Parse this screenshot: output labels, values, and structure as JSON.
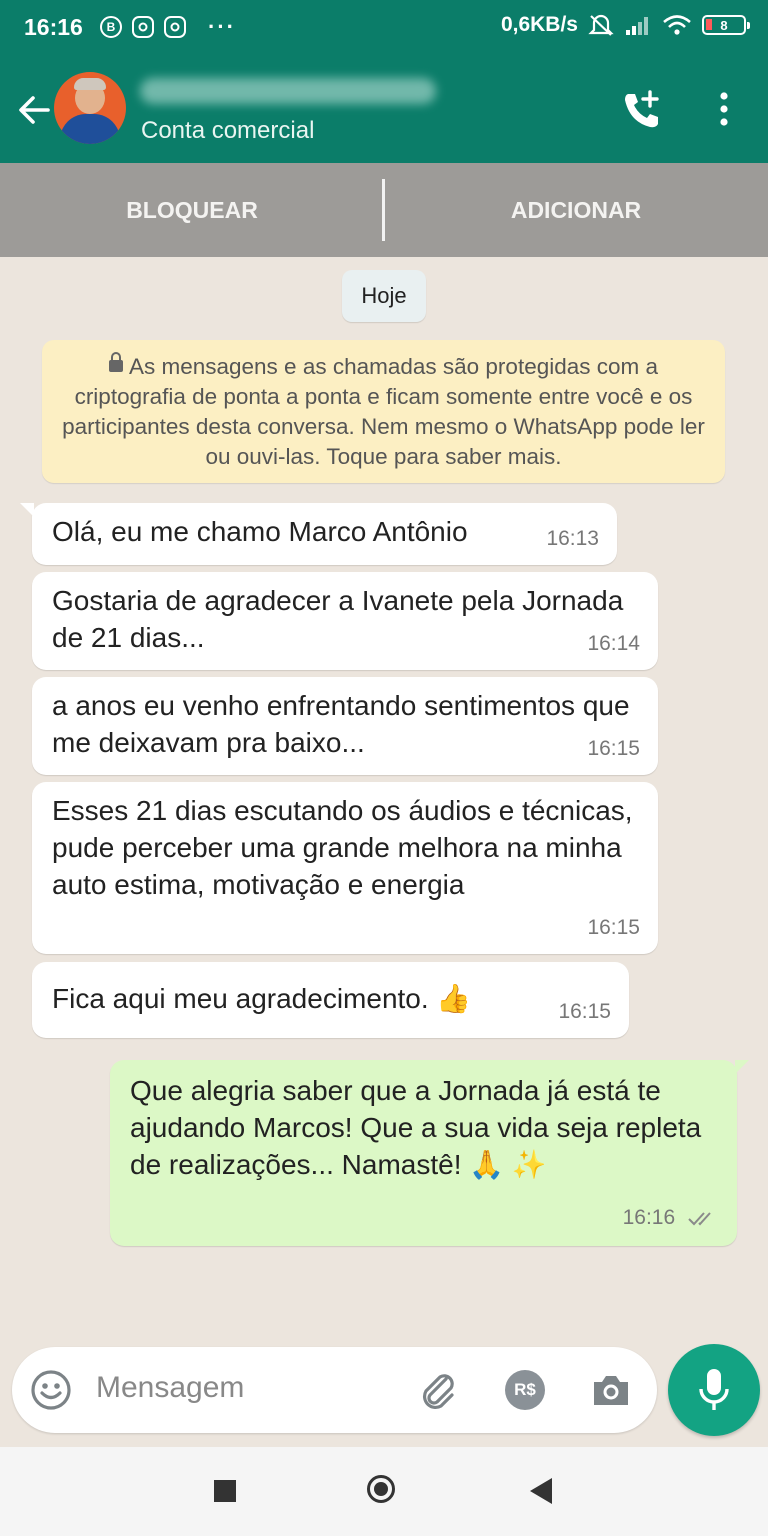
{
  "status_bar": {
    "time": "16:16",
    "icons": [
      "b-badge-icon",
      "instagram-icon",
      "instagram-icon"
    ],
    "b_badge_text": "B",
    "more": "···",
    "network_speed": "0,6KB/s",
    "battery_level": "8"
  },
  "header": {
    "contact_name_blurred": true,
    "subtitle": "Conta comercial",
    "accent_color": "#0b7d69"
  },
  "actions": {
    "block_label": "BLOQUEAR",
    "add_label": "ADICIONAR"
  },
  "chat": {
    "day_label": "Hoje",
    "encryption_notice": "As mensagens e as chamadas são protegidas com a criptografia de ponta a ponta e ficam somente entre você e os participantes desta conversa. Nem mesmo o WhatsApp pode ler ou ouvi-las. Toque para saber mais.",
    "messages": [
      {
        "direction": "in",
        "text": "Olá, eu me chamo Marco Antônio",
        "time": "16:13"
      },
      {
        "direction": "in",
        "text": "Gostaria de agradecer a Ivanete pela Jornada de 21 dias...",
        "time": "16:14"
      },
      {
        "direction": "in",
        "text": "a anos eu venho enfrentando sentimentos que me deixavam pra baixo...",
        "time": "16:15"
      },
      {
        "direction": "in",
        "text": "Esses 21 dias escutando os áudios e técnicas, pude perceber uma grande melhora na minha auto estima, motivação e energia",
        "time": "16:15"
      },
      {
        "direction": "in",
        "text": "Fica aqui meu agradecimento. 👍",
        "time": "16:15"
      },
      {
        "direction": "out",
        "text": "Que alegria saber que a Jornada já está te ajudando Marcos! Que a sua vida seja repleta de realizações... Namastê! 🙏 ✨",
        "time": "16:16",
        "status": "read-ticks"
      }
    ]
  },
  "composer": {
    "placeholder": "Mensagem",
    "pay_label": "R$"
  }
}
